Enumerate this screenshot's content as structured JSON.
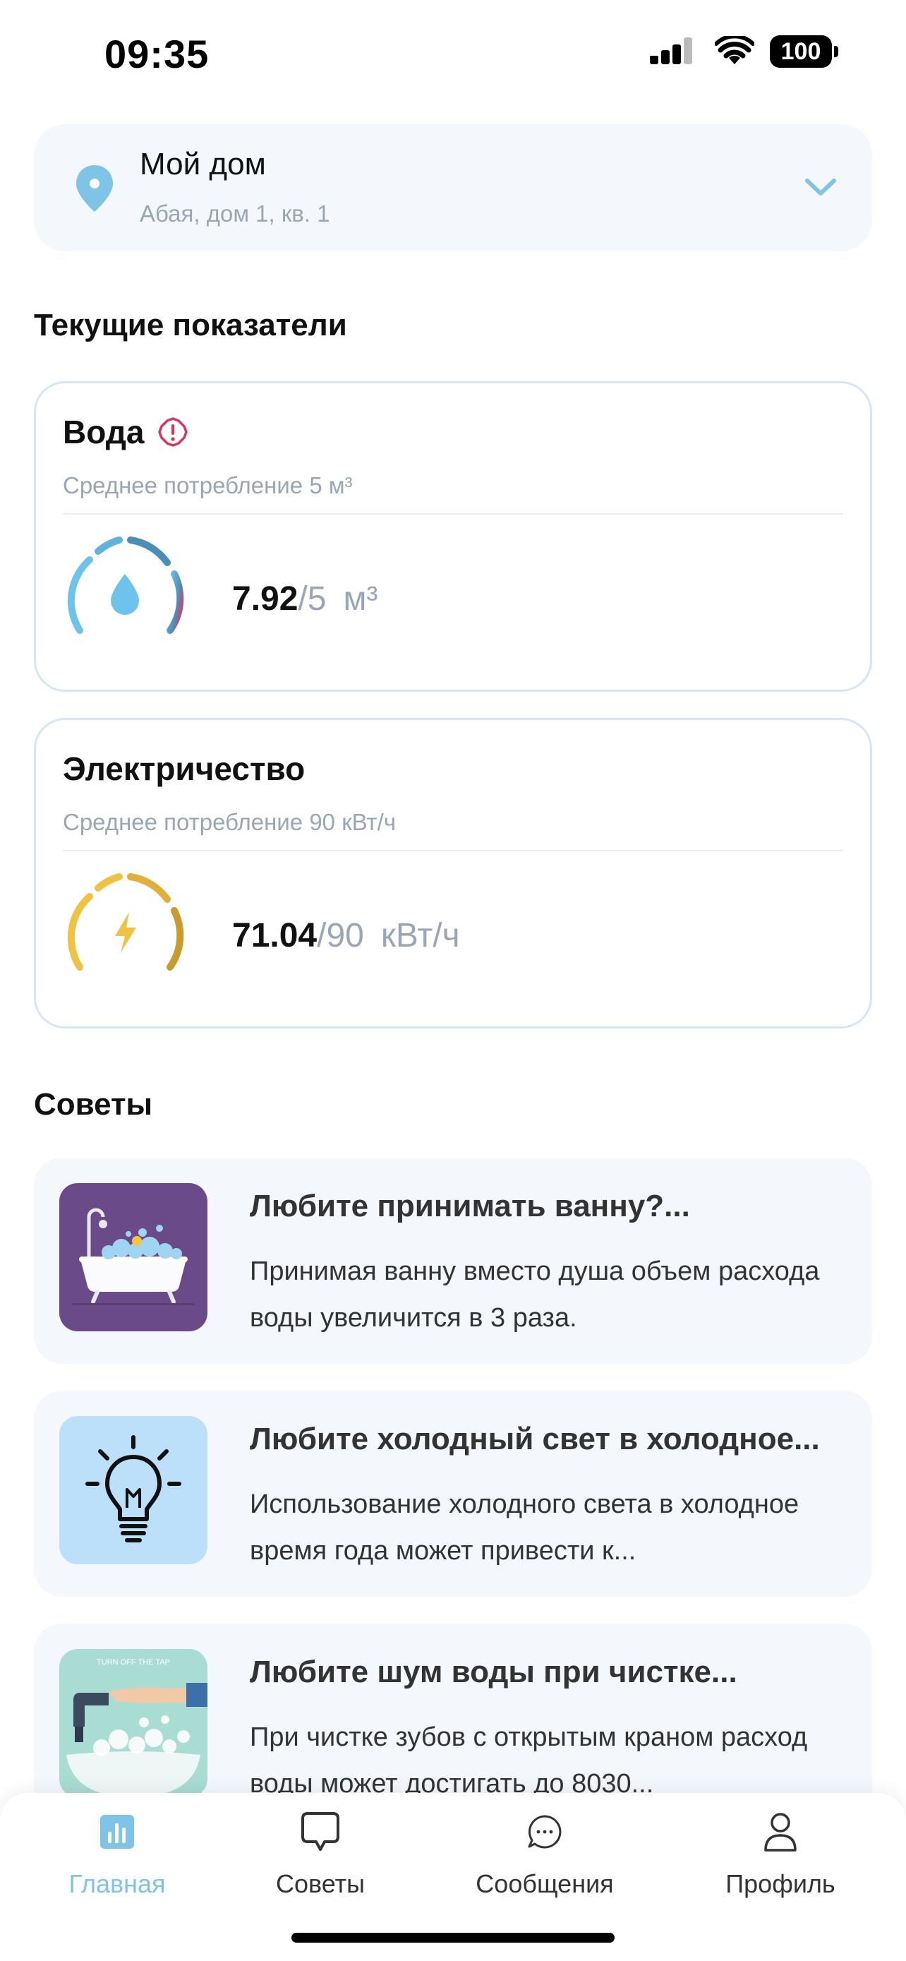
{
  "status": {
    "time": "09:35",
    "battery": "100"
  },
  "location": {
    "title": "Мой дом",
    "address": "Абая, дом 1, кв. 1",
    "pin_icon": "location-pin-icon",
    "expand_icon": "chevron-down-icon"
  },
  "indicators": {
    "section_title": "Текущие показатели",
    "water": {
      "title": "Вода",
      "warning_icon": "warning-icon",
      "subtitle": "Среднее потребление 5 м³",
      "current": "7.92",
      "limit": "/5",
      "unit": "м³",
      "gauge_icon": "water-drop-icon"
    },
    "electricity": {
      "title": "Электричество",
      "subtitle": "Среднее потребление 90 кВт/ч",
      "current": "71.04",
      "limit": "/90",
      "unit": "кВт/ч",
      "gauge_icon": "lightning-icon"
    }
  },
  "tips": {
    "section_title": "Советы",
    "items": [
      {
        "title": "Любите принимать ванну?...",
        "text": "Принимая ванну вместо душа объем расхода воды увеличится в 3 раза."
      },
      {
        "title": "Любите холодный свет в холодное...",
        "text": "Использование холодного света в холодное время года может привести к..."
      },
      {
        "title": "Любите шум воды при чистке...",
        "text": "При чистке зубов с открытым краном расход воды может достигать до 8030...",
        "image_caption": "TURN OFF THE TAP"
      }
    ]
  },
  "tab_bar": {
    "items": [
      {
        "label": "Главная",
        "icon": "chart-icon",
        "active": true
      },
      {
        "label": "Советы",
        "icon": "chat-bubble-icon"
      },
      {
        "label": "Сообщения",
        "icon": "message-icon"
      },
      {
        "label": "Профиль",
        "icon": "profile-icon"
      }
    ]
  },
  "colors": {
    "accent": "#7fc3e6",
    "card_bg": "#f4f7fb",
    "muted_text": "#9aa6b8",
    "warning": "#d9365c",
    "water_gauge": "#5fb3dc",
    "electricity_gauge": "#f0c244"
  }
}
